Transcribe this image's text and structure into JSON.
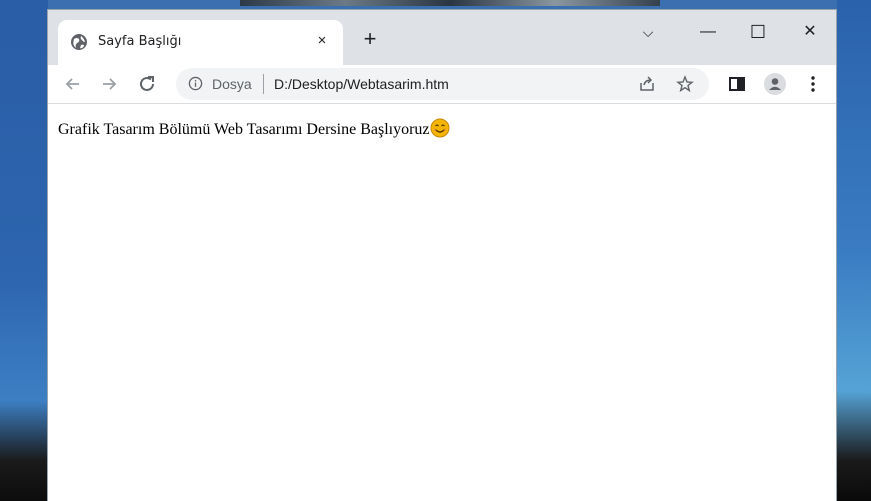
{
  "browser": {
    "tab": {
      "title": "Sayfa Başlığı",
      "icon": "globe-icon",
      "close_glyph": "×"
    },
    "new_tab_glyph": "+",
    "window_controls": {
      "tab_search_glyph": "⌵",
      "minimize_glyph": "—",
      "maximize_glyph": "☐",
      "close_glyph": "✕"
    },
    "toolbar": {
      "back_icon": "arrow-left-icon",
      "forward_icon": "arrow-right-icon",
      "reload_icon": "reload-icon",
      "address": {
        "scheme_label": "Dosya",
        "url": "D:/Desktop/Webtasarim.htm"
      },
      "share_icon": "share-icon",
      "bookmark_icon": "star-icon",
      "side_panel_icon": "side-panel-icon",
      "profile_icon": "profile-icon",
      "menu_icon": "kebab-menu-icon"
    }
  },
  "page": {
    "text": "Grafik Tasarım Bölümü Web Tasarımı Dersine Başlıyoruz",
    "emoji": "smiling-face-icon"
  },
  "colors": {
    "titlebar": "#dee1e6",
    "omnibox": "#f1f3f4",
    "emoji": "#f4b400"
  }
}
